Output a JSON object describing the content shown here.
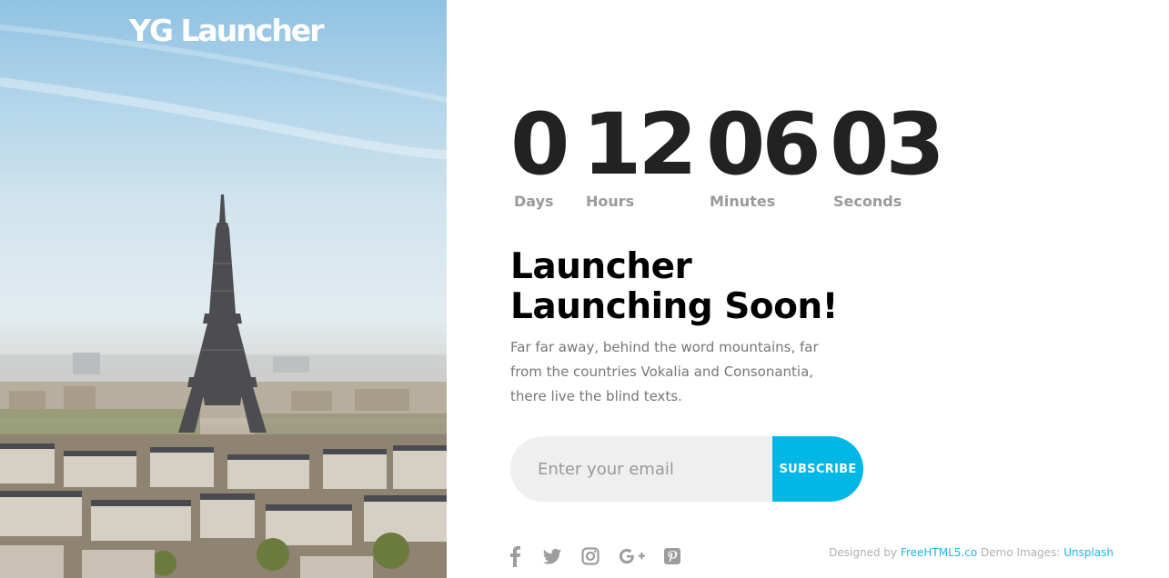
{
  "brand": {
    "name": "YG Launcher"
  },
  "countdown": [
    {
      "value": "0",
      "label": "Days"
    },
    {
      "value": "12",
      "label": "Hours"
    },
    {
      "value": "06",
      "label": "Minutes"
    },
    {
      "value": "03",
      "label": "Seconds"
    }
  ],
  "hero": {
    "title_line1": "Launcher",
    "title_line2": "Launching Soon!",
    "description": "Far far away, behind the word mountains, far from the countries Vokalia and Consonantia, there live the blind texts."
  },
  "subscribe": {
    "placeholder": "Enter your email",
    "button_label": "SUBSCRIBE"
  },
  "social": [
    "facebook-icon",
    "twitter-icon",
    "instagram-icon",
    "google-plus-icon",
    "pinterest-icon"
  ],
  "footer": {
    "designed_by": "Designed by",
    "designer_link": "FreeHTML5.co",
    "demo_images": "Demo Images:",
    "images_link": "Unsplash"
  },
  "colors": {
    "accent": "#00b7e6",
    "heading": "#222222",
    "muted": "#9a9a9a",
    "link": "#1fb6e8",
    "input_bg": "#efefef"
  }
}
